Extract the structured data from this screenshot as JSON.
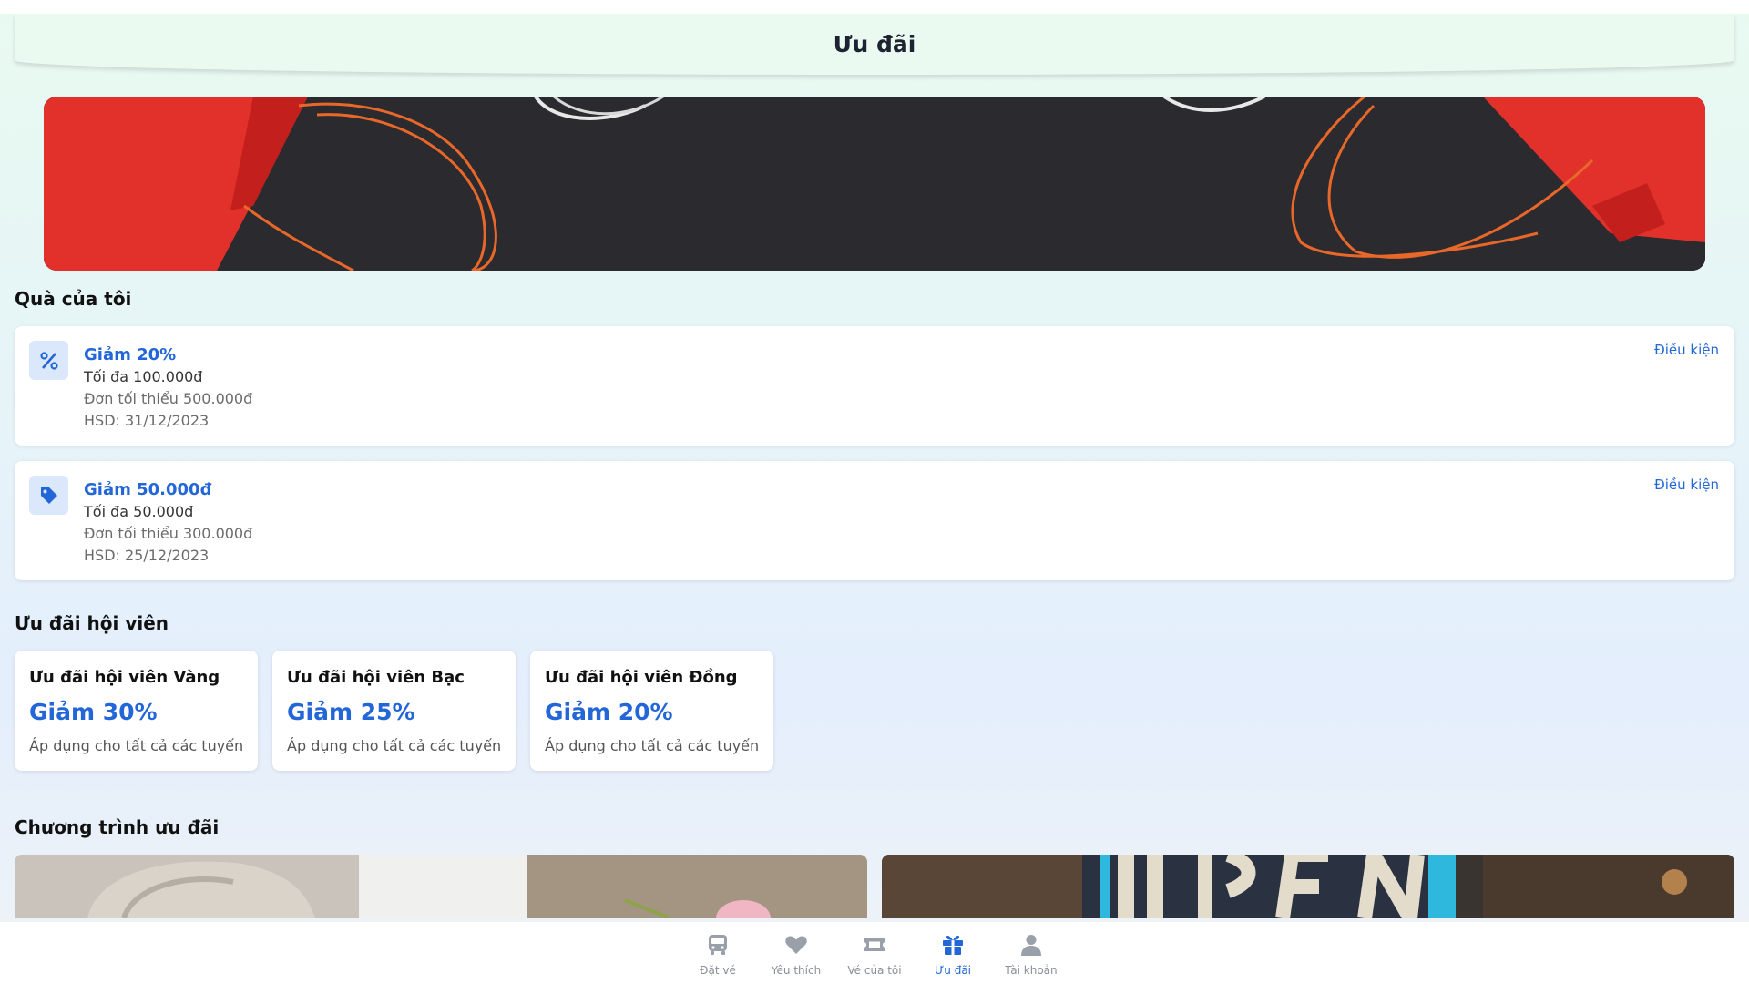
{
  "header": {
    "title": "Ưu đãi"
  },
  "sections": {
    "my_gifts": "Quà của tôi",
    "member": "Ưu đãi hội viên",
    "programs": "Chương trình ưu đãi"
  },
  "gifts": [
    {
      "icon": "percent-icon",
      "title": "Giảm 20%",
      "max": "Tối đa 100.000đ",
      "min_order": "Đơn tối thiểu 500.000đ",
      "expiry": "HSD: 31/12/2023",
      "condition_link": "Điều kiện"
    },
    {
      "icon": "tag-icon",
      "title": "Giảm 50.000đ",
      "max": "Tối đa 50.000đ",
      "min_order": "Đơn tối thiểu 300.000đ",
      "expiry": "HSD: 25/12/2023",
      "condition_link": "Điều kiện"
    }
  ],
  "member_offers": [
    {
      "title": "Ưu đãi hội viên Vàng",
      "discount": "Giảm 30%",
      "desc": "Áp dụng cho tất cả các tuyến"
    },
    {
      "title": "Ưu đãi hội viên Bạc",
      "discount": "Giảm 25%",
      "desc": "Áp dụng cho tất cả các tuyến"
    },
    {
      "title": "Ưu đãi hội viên Đồng",
      "discount": "Giảm 20%",
      "desc": "Áp dụng cho tất cả các tuyến"
    }
  ],
  "nav": [
    {
      "icon": "bus-icon",
      "label": "Đặt vé",
      "active": false
    },
    {
      "icon": "heart-icon",
      "label": "Yêu thích",
      "active": false
    },
    {
      "icon": "ticket-icon",
      "label": "Vé của tôi",
      "active": false
    },
    {
      "icon": "gift-icon",
      "label": "Ưu đãi",
      "active": true
    },
    {
      "icon": "user-icon",
      "label": "Tài khoản",
      "active": false
    }
  ],
  "colors": {
    "accent": "#2266d8",
    "nav_inactive": "#8a8f98",
    "banner_bag": "#e2302b",
    "banner_string": "#e8682a"
  }
}
